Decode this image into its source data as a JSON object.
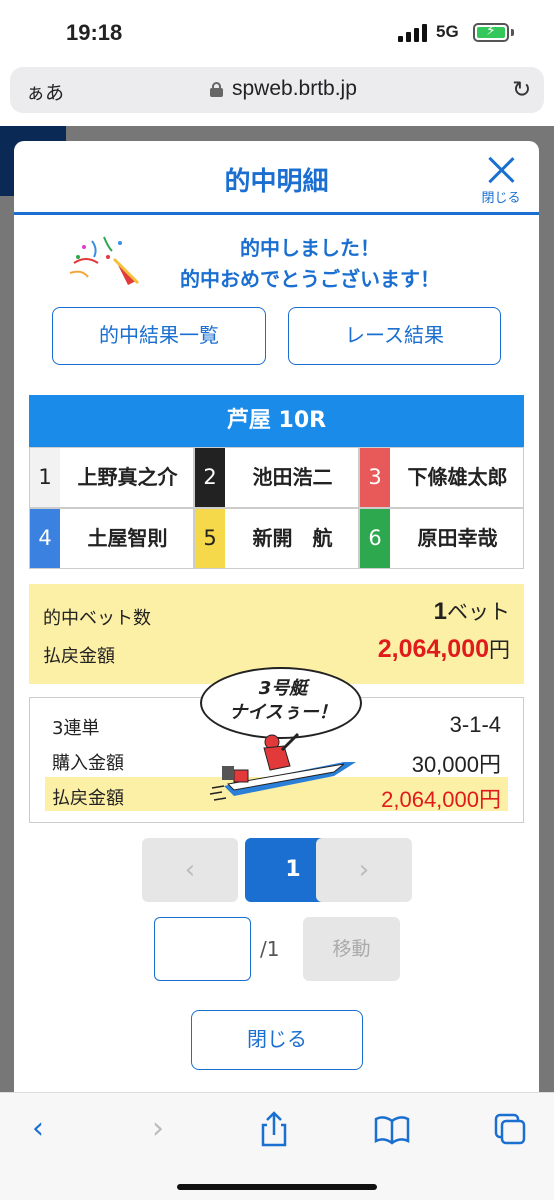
{
  "status": {
    "time": "19:18",
    "network": "5G"
  },
  "browser": {
    "aa_label": "ぁあ",
    "url": "spweb.brtb.jp"
  },
  "modal": {
    "title": "的中明細",
    "close_label": "閉じる",
    "congrats_line1": "的中しました！",
    "congrats_line2": "的中おめでとうございます！",
    "hit_list_button": "的中結果一覧",
    "race_result_button": "レース結果",
    "race_title": "芦屋 10R",
    "racers": [
      {
        "num": "1",
        "name": "上野真之介",
        "color": "#f2f2f2",
        "text_color": "#222"
      },
      {
        "num": "2",
        "name": "池田浩二",
        "color": "#222222",
        "text_color": "#ffffff"
      },
      {
        "num": "3",
        "name": "下條雄太郎",
        "color": "#e85a5a",
        "text_color": "#ffffff"
      },
      {
        "num": "4",
        "name": "土屋智則",
        "color": "#3b82e0",
        "text_color": "#ffffff"
      },
      {
        "num": "5",
        "name": "新開　航",
        "color": "#f5d94a",
        "text_color": "#222"
      },
      {
        "num": "6",
        "name": "原田幸哉",
        "color": "#2ea84f",
        "text_color": "#ffffff"
      }
    ],
    "summary": {
      "bet_count_label": "的中ベット数",
      "bet_count_value": "1",
      "bet_count_unit": "ベット",
      "payout_label": "払戻金額",
      "payout_value": "2,064,000",
      "payout_unit": "円"
    },
    "detail": {
      "bet_type": "3連単",
      "combination": "3-1-4",
      "purchase_label": "購入金額",
      "purchase_value": "30,000円",
      "payout_label": "払戻金額",
      "payout_value": "2,064,000円"
    },
    "bubble_line1": "3号艇",
    "bubble_line2": "ナイスぅー！",
    "pager": {
      "prev": "‹",
      "current": "1",
      "next": "›",
      "total": "/1",
      "go_label": "移動"
    },
    "close_button": "閉じる"
  },
  "colors": {
    "accent": "#1a6fd0",
    "highlight": "#fcefa6",
    "payout_red": "#e01b1b"
  }
}
